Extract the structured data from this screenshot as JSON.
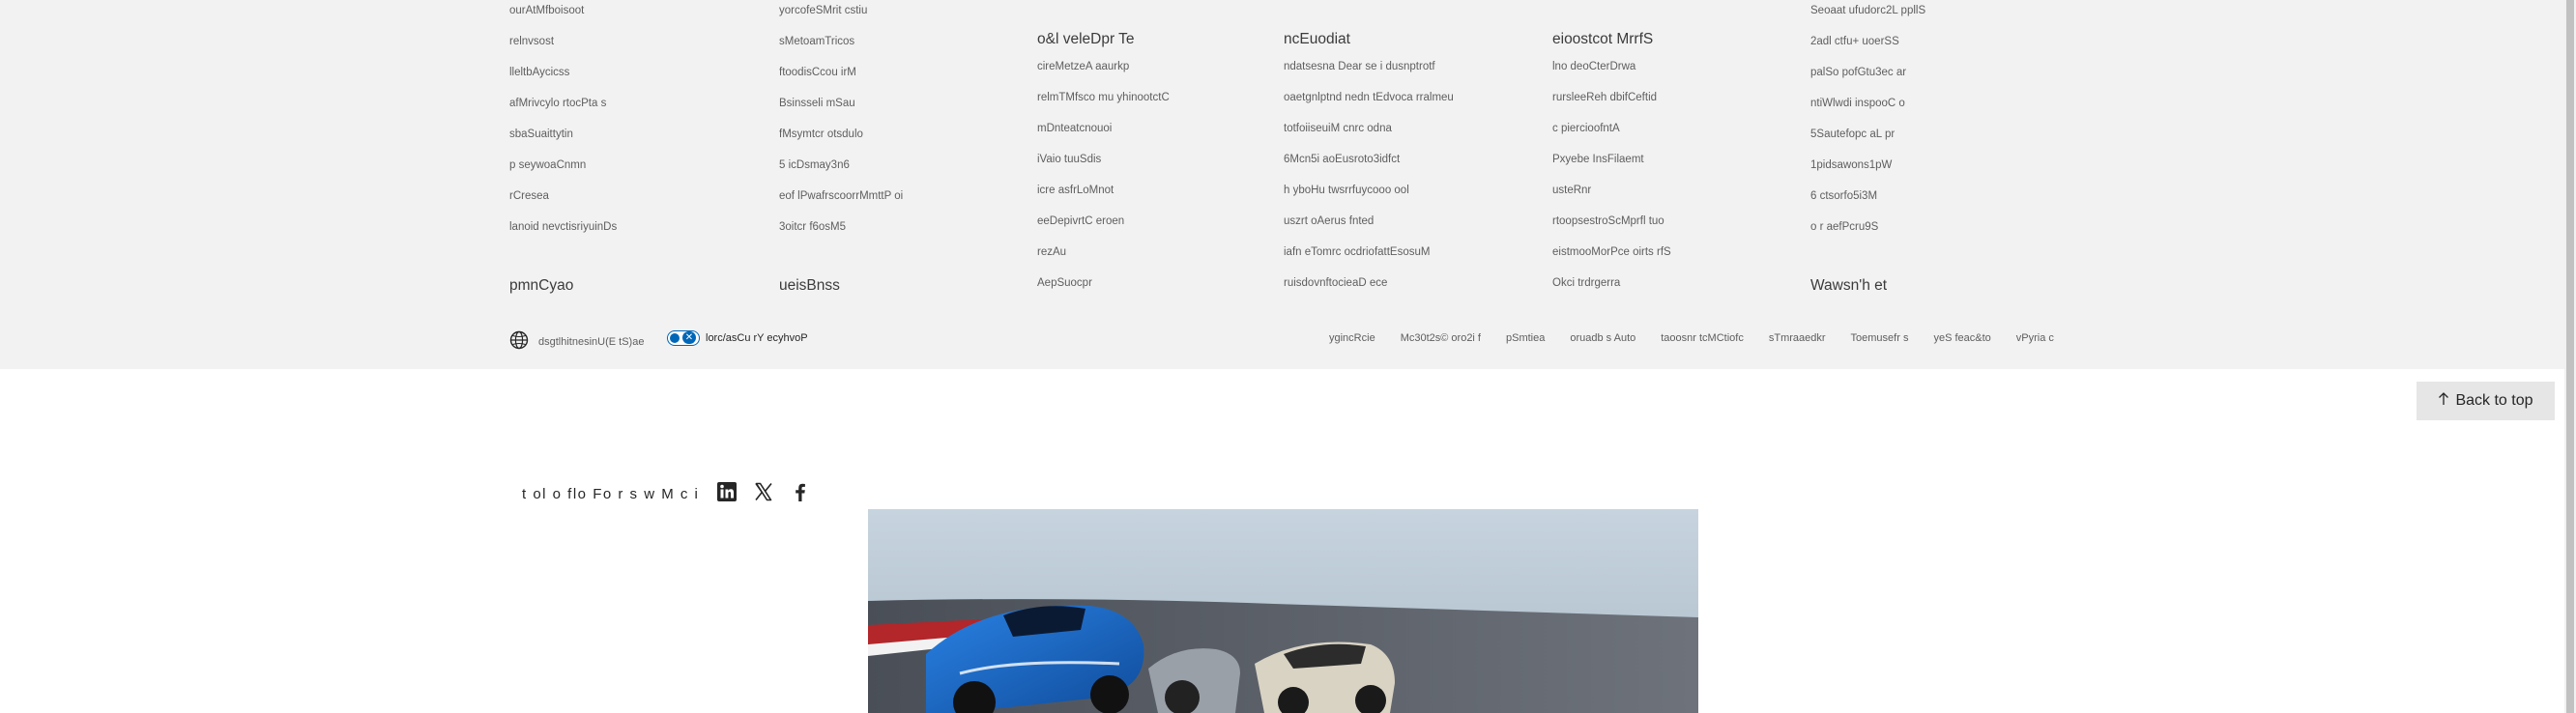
{
  "footer": {
    "columns": [
      {
        "heading": "",
        "links": [
          "ourAtMfboisoot",
          "relnvsost",
          "lleltbAycicss",
          "afMrivcylo rtocPta s",
          "sbaSuaittytin",
          "p seywoaCnmn",
          "rCresea",
          "lanoid nevctisriyuinDs"
        ]
      },
      {
        "heading": "",
        "links": [
          "yorcofeSMrit cstiu",
          "sMetoamTricos",
          "ftoodisCcou irM",
          "Bsinsseli mSau",
          "fMsymtcr otsdulo",
          "5 icDsmay3n6",
          "eof lPwafrscoorrMmttP oi",
          "3oitcr f6osM5"
        ]
      },
      {
        "heading": "o&l veleDpr Te",
        "links": [
          "cireMetzeA aaurkp",
          "relmTMfsco mu yhinootctC",
          "mDnteatcnouoi",
          "iVaio tuuSdis",
          "icre asfrLoMnot",
          "eeDepivrtC eroen",
          "rezAu",
          "AepSuocpr"
        ]
      },
      {
        "heading": "ncEuodiat",
        "links": [
          "ndatsesna Dear se i dusnptrotf",
          "oaetgnlptnd nedn tEdvoca rralmeu",
          "totfoiiseuiM cnrc odna",
          "6Mcn5i aoEusroto3idfct",
          "h yboHu twsrrfuycooo ool",
          "uszrt oAerus fnted",
          "iafn eTomrc ocdriofattEsosuM",
          "ruisdovnftocieaD ece"
        ]
      },
      {
        "heading": "eioostcot MrrfS",
        "links": [
          "lno deoCterDrwa",
          "rursleeReh dbifCeftid",
          "c piercioofntA",
          "Pxyebe InsFilaemt",
          "usteRnr",
          "rtoopsestroScMprfl tuo",
          "eistmooMorPce oirts rfS",
          "Okci trdrgerra"
        ]
      },
      {
        "heading": "",
        "links": [
          "Seoaat ufudorc2L ppllS",
          "2adl ctfu+ uoerSS",
          "palSo pofGtu3ec ar",
          "ntiWlwdi inspooC o",
          "5Sautefopc aL pr",
          "1pidsawons1pW",
          "6 ctsorfo5i3M",
          "o r aefPcru9S"
        ]
      }
    ],
    "lone_headings": {
      "col1": "pmnCyao",
      "col2": "ueisBnss",
      "col6": "Wawsn'h et"
    },
    "locale_text": "dsgtlhitnesinU(E tS)ae",
    "privacy_text": "lorc/asCu rY ecyhvoP",
    "legal_links": [
      "ygincRcie",
      "Mc30t2s© oro2i f",
      "pSmtiea",
      "oruadb s Auto",
      "taoosnr tcMCtiofc",
      "sTmraaedkr",
      "Toemusefr s",
      "yeS feac&to",
      "vPyria c"
    ]
  },
  "back_to_top": {
    "label": "Back to top"
  },
  "share": {
    "label": "t ol o flo Fo r s w M c i"
  },
  "icons": {
    "globe": "globe-icon",
    "toggle": "privacy-choices-icon",
    "arrow": "arrow-up-icon",
    "linkedin": "linkedin-icon",
    "x": "x-icon",
    "facebook": "facebook-icon"
  },
  "colors": {
    "footer_bg": "#f2f2f2",
    "accent": "#0067b8",
    "car_blue": "#1f6fd1"
  }
}
